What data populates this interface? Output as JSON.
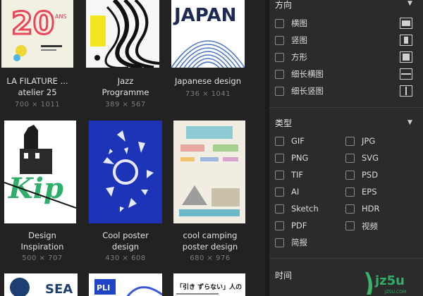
{
  "gallery": {
    "items": [
      {
        "title": "LA FILATURE ...",
        "subtitle": "atelier 25",
        "dims": "700 × 1011",
        "poster_text": "20",
        "poster_sub": "ANS"
      },
      {
        "title": "Jazz",
        "subtitle": "Programme",
        "dims": "389 × 567"
      },
      {
        "title": "Japanese design",
        "subtitle": "",
        "dims": "736 × 1041",
        "poster_text": "JAPAN"
      },
      {
        "title": "Design",
        "subtitle": "Inspiration",
        "dims": "500 × 707",
        "poster_text": "Kip"
      },
      {
        "title": "Cool poster",
        "subtitle": "design",
        "dims": "430 × 608"
      },
      {
        "title": "cool camping",
        "subtitle": "poster design",
        "dims": "680 × 976"
      },
      {
        "title": "",
        "subtitle": "",
        "dims": "",
        "poster_text": "SEA"
      },
      {
        "title": "",
        "subtitle": "",
        "dims": "",
        "poster_text": "PLI"
      },
      {
        "title": "",
        "subtitle": "",
        "dims": "",
        "poster_text": "「引き ずらない」人の"
      }
    ]
  },
  "filters": {
    "orientation": {
      "title": "方向",
      "options": [
        "横图",
        "竖图",
        "方形",
        "细长横图",
        "细长竖图"
      ]
    },
    "type": {
      "title": "类型",
      "left": [
        "GIF",
        "PNG",
        "TIF",
        "AI",
        "Sketch",
        "PDF",
        "简报"
      ],
      "right": [
        "JPG",
        "SVG",
        "PSD",
        "EPS",
        "HDR",
        "视频"
      ]
    },
    "time": {
      "title": "时间"
    }
  },
  "watermark": {
    "brand": "jz5u",
    "site": "JZ5U.COM"
  },
  "colors": {
    "panel_bg": "#2b2b2b",
    "gallery_bg": "#222222",
    "accent_green": "#2fae6a"
  }
}
